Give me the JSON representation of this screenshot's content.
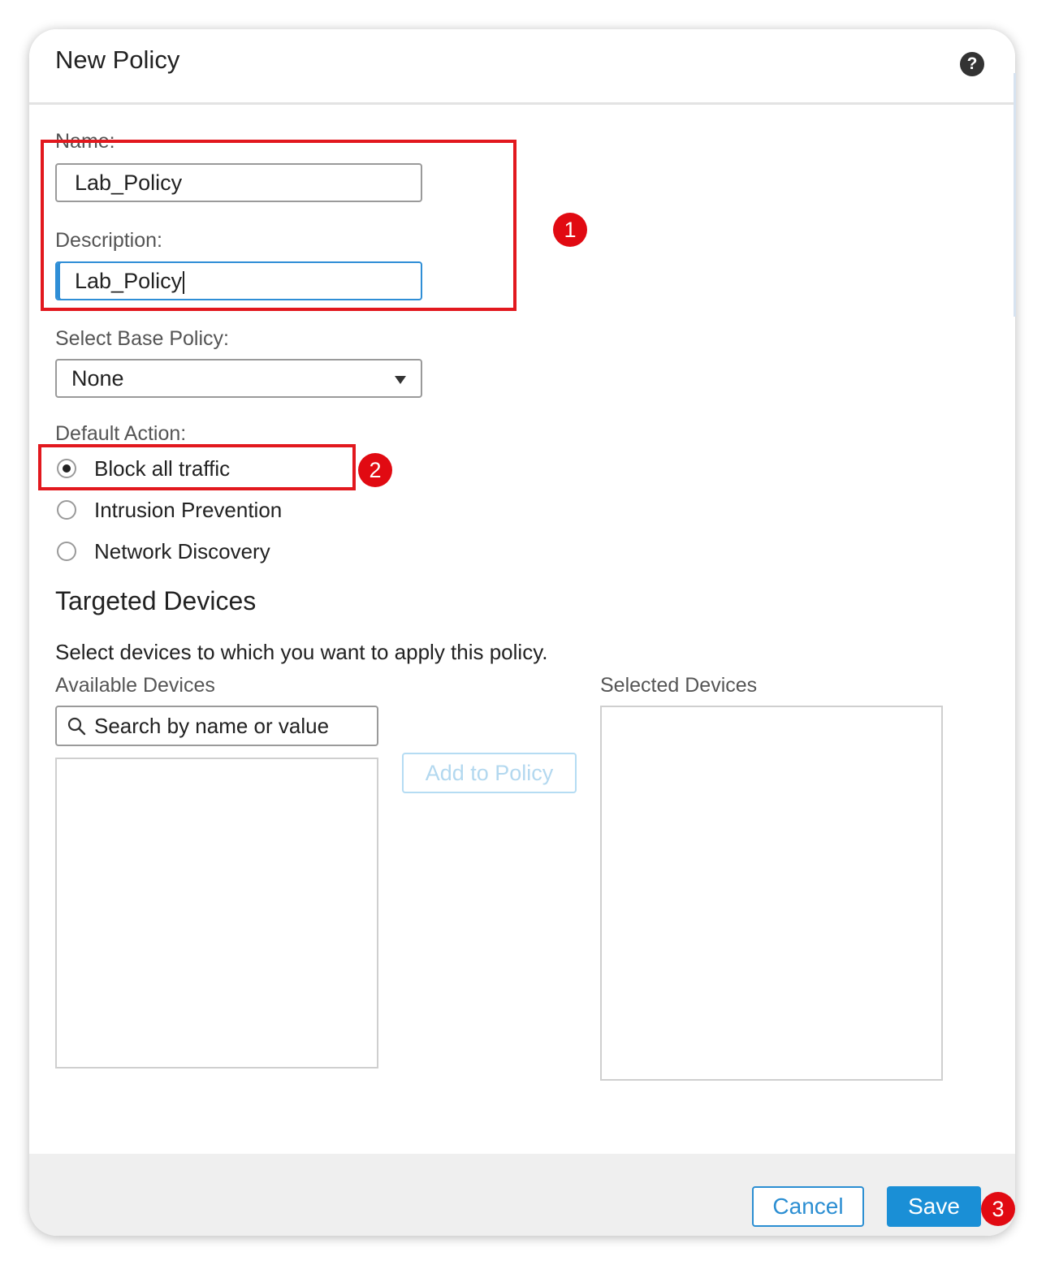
{
  "dialog": {
    "title": "New Policy",
    "help_icon": "question-circle-icon"
  },
  "form": {
    "name_label": "Name:",
    "name_value": "Lab_Policy",
    "description_label": "Description:",
    "description_value": "Lab_Policy",
    "base_policy_label": "Select Base Policy:",
    "base_policy_value": "None",
    "default_action_label": "Default Action:",
    "default_actions": [
      {
        "label": "Block all traffic",
        "checked": true
      },
      {
        "label": "Intrusion Prevention",
        "checked": false
      },
      {
        "label": "Network Discovery",
        "checked": false
      }
    ]
  },
  "targeted_devices": {
    "title": "Targeted Devices",
    "description": "Select devices to which you want to apply this policy.",
    "available_label": "Available Devices",
    "search_placeholder": "Search by name or value",
    "add_button": "Add to Policy",
    "selected_label": "Selected Devices",
    "available_items": [],
    "selected_items": []
  },
  "footer": {
    "cancel_label": "Cancel",
    "save_label": "Save"
  },
  "annotations": {
    "badge_1": "1",
    "badge_2": "2",
    "badge_3": "3"
  },
  "colors": {
    "accent": "#1a8fd6",
    "highlight": "#e2181e"
  }
}
